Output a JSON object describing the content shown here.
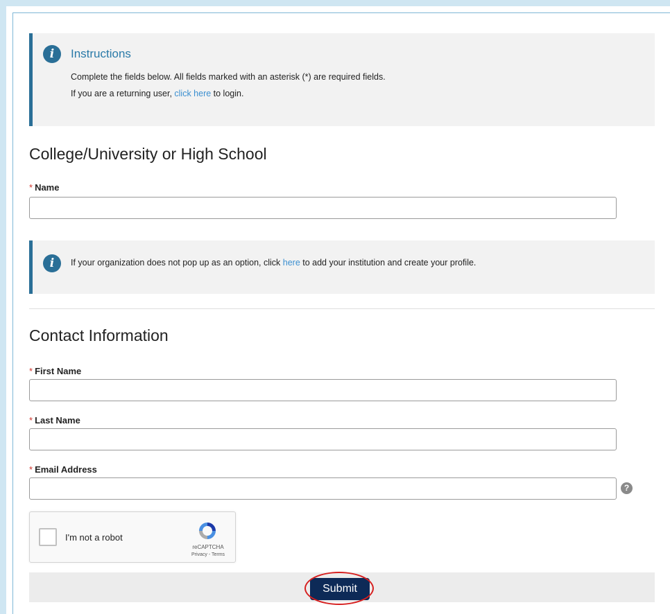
{
  "instructions": {
    "title": "Instructions",
    "line1": "Complete the fields below. All fields marked with an asterisk (*) are required fields.",
    "line2_before": "If you are a returning user, ",
    "line2_link": "click here",
    "line2_after": " to login."
  },
  "school_section": {
    "title": "College/University or High School",
    "name_label": "Name",
    "name_value": "",
    "required_mark": "*"
  },
  "org_notice": {
    "before": "If your organization does not pop up as an option, click ",
    "link": "here",
    "after": " to add your institution and create your profile."
  },
  "contact_section": {
    "title": "Contact Information",
    "first_name_label": "First Name",
    "last_name_label": "Last Name",
    "email_label": "Email Address",
    "required_mark": "*",
    "help_icon": "question-icon",
    "help_glyph": "?"
  },
  "recaptcha": {
    "label": "I'm not a robot",
    "brand": "reCAPTCHA",
    "terms": "Privacy - Terms"
  },
  "submit_label": "Submit",
  "colors": {
    "accent": "#2a6f97",
    "link": "#3b8fd0",
    "required": "#d0342c",
    "submit_bg": "#0d2a57",
    "highlight": "#d61f1f"
  }
}
